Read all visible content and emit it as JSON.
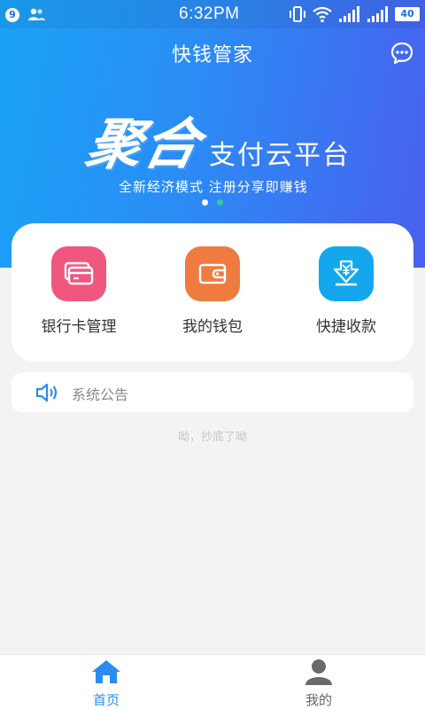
{
  "status_bar": {
    "notification_count": "9",
    "time": "6:32PM",
    "battery": "40",
    "icons": [
      "contacts-icon",
      "vibrate-icon",
      "wifi-icon",
      "signal-icon",
      "signal-icon",
      "battery-icon"
    ]
  },
  "header": {
    "title": "快钱管家",
    "message_icon": "chat-bubble-icon"
  },
  "banner": {
    "brand": "聚合",
    "title": "支付云平台",
    "subtitle": "全新经济模式 注册分享即赚钱",
    "slides": 2,
    "active_slide": 1
  },
  "functions": [
    {
      "label": "银行卡管理",
      "icon": "bank-card-icon",
      "color": "#f0577f"
    },
    {
      "label": "我的钱包",
      "icon": "wallet-icon",
      "color": "#f07b3f"
    },
    {
      "label": "快捷收款",
      "icon": "quick-receive-icon",
      "color": "#13a8ee"
    }
  ],
  "notice": {
    "icon": "speaker-icon",
    "text": "系统公告"
  },
  "end_message": "呦，抄底了呦",
  "bottom_nav": [
    {
      "label": "首页",
      "icon": "home-icon",
      "active": true
    },
    {
      "label": "我的",
      "icon": "user-icon",
      "active": false
    }
  ],
  "colors": {
    "gradient_start": "#1aa3f7",
    "gradient_end": "#4a5ff0",
    "accent": "#2a8cf0",
    "background": "#f3f3f3",
    "dot_active": "#2fcf91",
    "dot_inactive": "#ffffff",
    "nav_inactive": "#666666"
  }
}
